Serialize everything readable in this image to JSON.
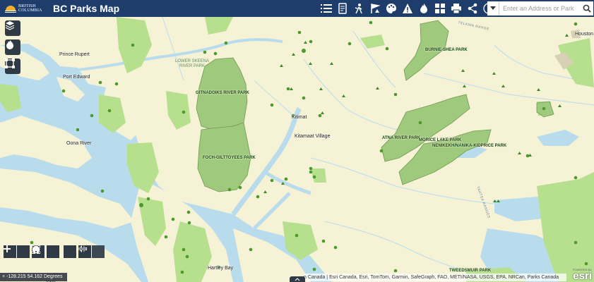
{
  "header": {
    "logo_line1": "BRITISH",
    "logo_line2": "COLUMBIA",
    "title": "BC Parks Map"
  },
  "toolbar": {
    "icons": [
      "list-icon",
      "document-icon",
      "hiking-icon",
      "flag-icon",
      "palette-icon",
      "warning-icon",
      "fire-icon",
      "grid-icon",
      "printer-icon",
      "share-icon",
      "info-icon"
    ]
  },
  "search": {
    "placeholder": "Enter an Address or Park"
  },
  "map": {
    "places": {
      "prince_rupert": "Prince Rupert",
      "port_edward": "Port Edward",
      "oona_river": "Oona River",
      "kitimat": "Kitimat",
      "kitamaat_village": "Kitamaat Village",
      "hartley_bay": "Hartley Bay",
      "houston": "Houston"
    },
    "parks": {
      "lower_skeena": "LOWER SKEENA RIVER PARK",
      "gitnadoiks": "GITNADOIKS RIVER PARK",
      "foch": "FOCH-GILTTOYEES PARK",
      "burnie_shea": "BURNIE-SHEA PARK",
      "atna": "ATNA RIVER PARK",
      "morice": "MORICE LAKE PARK",
      "nenikekh": "NENIKEKH/NANIKA-KIDPRICE PARK",
      "tweedsmuir": "TWEEDSMUIR PARK"
    },
    "ranges": {
      "telkwa": "TELKWA RANGE",
      "tahtsa": "TAHTSA RANGES"
    }
  },
  "footer": {
    "coordinates": "-128.215 54.162 Degrees",
    "scale_label": "20km",
    "attribution": "n Canada | Esri Canada, Esri, TomTom, Garmin, SafeGraph, FAO, METI/NASA, USGS, EPA, NRCan, Parks Canada",
    "powered_by": "POWERED BY",
    "esri": "esri"
  },
  "colors": {
    "header_bg": "#1f3d6b",
    "land": "#f5f2d6",
    "water": "#b9dced",
    "protected_area": "#b6df8e",
    "park_outline": "#86b366",
    "park_fill": "#9fc97c",
    "marker": "#4c9a2a",
    "control_bg": "#2f3a45"
  }
}
